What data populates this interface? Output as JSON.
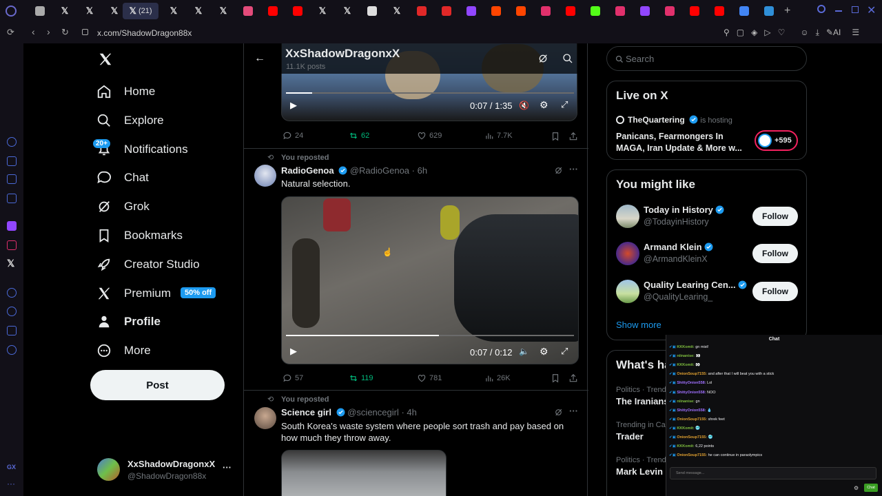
{
  "browser": {
    "url": "x.com/ShadowDragon88x",
    "active_tab_label": "(21)",
    "tabs": [
      "mail",
      "x",
      "x",
      "x",
      "x",
      "x",
      "x",
      "x",
      "x-dev",
      "youtube",
      "youtube",
      "x",
      "x",
      "news",
      "x",
      "flipboard",
      "flipboard",
      "twitch",
      "reddit",
      "reddit",
      "instagram",
      "youtube",
      "kick",
      "instagram",
      "twitch",
      "instagram",
      "youtube",
      "youtube",
      "google",
      "photos"
    ],
    "toolbar_right": {
      "ai_label": "AI"
    }
  },
  "nav": {
    "logo": "x-logo-icon",
    "items": [
      {
        "label": "Home",
        "icon": "home-icon"
      },
      {
        "label": "Explore",
        "icon": "search-icon"
      },
      {
        "label": "Notifications",
        "icon": "bell-icon",
        "badge": "20+"
      },
      {
        "label": "Chat",
        "icon": "chat-bubble-icon"
      },
      {
        "label": "Grok",
        "icon": "grok-icon"
      },
      {
        "label": "Bookmarks",
        "icon": "bookmark-icon"
      },
      {
        "label": "Creator Studio",
        "icon": "rocket-icon"
      },
      {
        "label": "Premium",
        "icon": "x-logo-icon",
        "badge": "50% off"
      },
      {
        "label": "Profile",
        "icon": "person-icon"
      },
      {
        "label": "More",
        "icon": "more-circle-icon"
      }
    ],
    "post_label": "Post",
    "account": {
      "name": "XxShadowDragonxX",
      "handle": "@ShadowDragon88x",
      "more": "···"
    }
  },
  "header": {
    "name": "XxShadowDragonxX",
    "posts_count": "11.1K posts"
  },
  "top_video": {
    "time": "0:07 / 1:35",
    "progress": 0.09
  },
  "top_actions": {
    "replies": "24",
    "reposts": "62",
    "likes": "629",
    "views": "7.7K"
  },
  "posts": [
    {
      "context": "You reposted",
      "name": "RadioGenoa",
      "handle": "@RadioGenoa",
      "time": "· 6h",
      "text": "Natural selection.",
      "video_time": "0:07 / 0:12",
      "video_progress": 0.53,
      "replies": "57",
      "reposts": "119",
      "likes": "781",
      "views": "26K"
    },
    {
      "context": "You reposted",
      "name": "Science girl",
      "handle": "@sciencegirl",
      "time": "· 4h",
      "text": "South Korea's waste system where people sort trash and pay based on how much they throw away."
    }
  ],
  "right": {
    "search_placeholder": "Search",
    "live": {
      "title": "Live on X",
      "host": "TheQuartering",
      "hosting": "is hosting",
      "space_title": "Panicans, Fearmongers In MAGA, Iran Update & More w...",
      "listeners": "+595"
    },
    "might_like": {
      "title": "You might like",
      "users": [
        {
          "name": "Today in History",
          "handle": "@TodayinHistory",
          "button": "Follow"
        },
        {
          "name": "Armand Klein",
          "handle": "@ArmandKleinX",
          "button": "Follow"
        },
        {
          "name": "Quality Learing Cen...",
          "handle": "@QualityLearing_",
          "button": "Follow"
        }
      ],
      "show_more": "Show more"
    },
    "happening": {
      "title": "What's ha",
      "trends": [
        {
          "meta": "Politics · Trend",
          "name": "The Iranians"
        },
        {
          "meta": "Trending in Ca",
          "name": "Trader"
        },
        {
          "meta": "Politics · Trend",
          "name": "Mark Levin"
        }
      ]
    }
  },
  "chat": {
    "title": "Chat",
    "messages": [
      {
        "user": "KKKomit:",
        "text": "gn mist!",
        "color": "#7fbf3f"
      },
      {
        "user": "niinanise:",
        "text": "👀",
        "color": "#7fbf3f"
      },
      {
        "user": "KKKomit:",
        "text": "👀",
        "color": "#7fbf3f"
      },
      {
        "user": "OnionSoup7155:",
        "text": "and after that I will beat you with a stick",
        "color": "#e0a030"
      },
      {
        "user": "ShittyOnion558:",
        "text": "Lol",
        "color": "#a070ff"
      },
      {
        "user": "ShittyOnion558:",
        "text": "NOO",
        "color": "#a070ff"
      },
      {
        "user": "niinanise:",
        "text": "gn",
        "color": "#7fbf3f"
      },
      {
        "user": "ShittyOnion558:",
        "text": "💧",
        "color": "#a070ff"
      },
      {
        "user": "OnionSoup7155:",
        "text": "shrek feet",
        "color": "#e0a030"
      },
      {
        "user": "KKKomit:",
        "text": "🥶",
        "color": "#7fbf3f"
      },
      {
        "user": "OnionSoup7155:",
        "text": "🥶",
        "color": "#e0a030"
      },
      {
        "user": "KKKomit:",
        "text": "6,22 points",
        "color": "#7fbf3f"
      },
      {
        "user": "OnionSoup7155:",
        "text": "he can continue in paraolympics",
        "color": "#e0a030"
      }
    ],
    "input_placeholder": "Send message...",
    "send_label": "Chat"
  },
  "colors": {
    "accent": "#1d9bf0",
    "repost_green": "#00ba7c",
    "chat_send": "#3a9d23"
  }
}
